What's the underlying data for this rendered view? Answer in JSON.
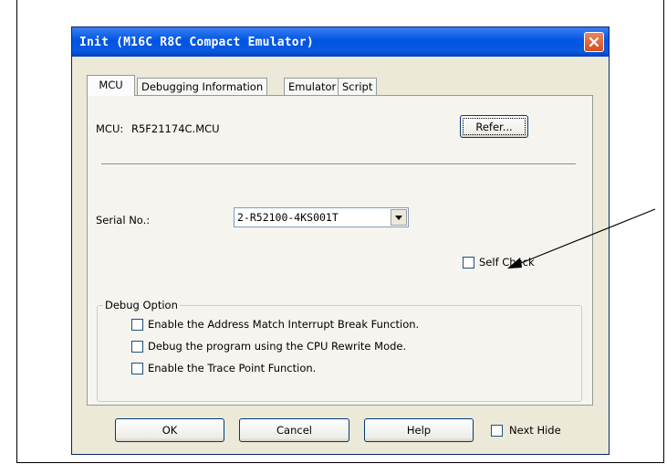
{
  "window": {
    "title": "Init (M16C R8C Compact Emulator)"
  },
  "tabs": [
    {
      "label": "MCU",
      "active": true
    },
    {
      "label": "Debugging Information",
      "active": false
    },
    {
      "label": "Emulator",
      "active": false
    },
    {
      "label": "Script",
      "active": false
    }
  ],
  "mcu": {
    "label": "MCU:",
    "value": "R5F21174C.MCU",
    "refer_button": "Refer..."
  },
  "serial": {
    "label": "Serial No.:",
    "value": "2-R52100-4KS001T"
  },
  "self_check": {
    "label": "Self Check",
    "checked": false
  },
  "debug_option": {
    "title": "Debug Option",
    "options": [
      {
        "label": "Enable the Address Match Interrupt Break Function.",
        "checked": false
      },
      {
        "label": "Debug the program using the CPU Rewrite Mode.",
        "checked": false
      },
      {
        "label": "Enable the Trace Point Function.",
        "checked": false
      }
    ]
  },
  "footer": {
    "ok": "OK",
    "cancel": "Cancel",
    "help": "Help",
    "next_hide": "Next Hide",
    "next_hide_checked": false
  },
  "colors": {
    "titlebar": "#0054e3",
    "dialog_bg": "#ece9d8",
    "close_button": "#d4501e"
  }
}
